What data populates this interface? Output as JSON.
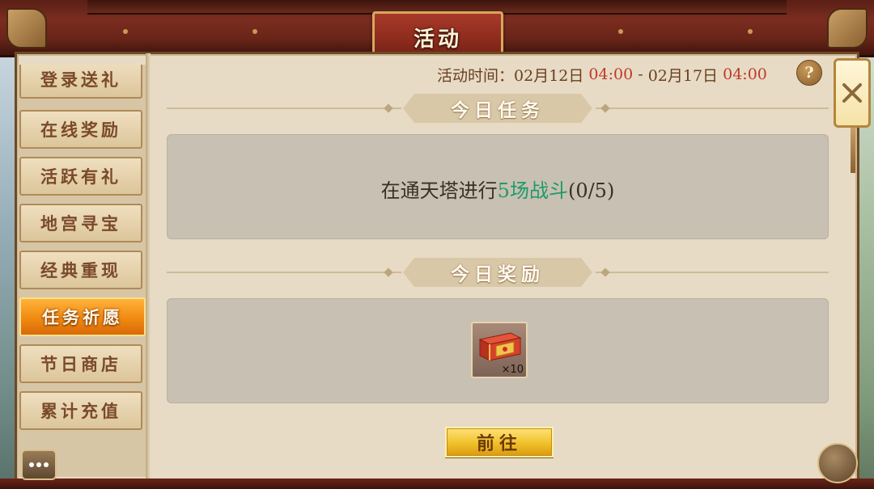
{
  "window": {
    "title": "活动"
  },
  "sidebar": {
    "items": [
      {
        "label": "登录送礼",
        "active": false
      },
      {
        "label": "在线奖励",
        "active": false
      },
      {
        "label": "活跃有礼",
        "active": false
      },
      {
        "label": "地宫寻宝",
        "active": false
      },
      {
        "label": "经典重现",
        "active": false
      },
      {
        "label": "任务祈愿",
        "active": true
      },
      {
        "label": "节日商店",
        "active": false
      },
      {
        "label": "累计充值",
        "active": false
      }
    ]
  },
  "event_time": {
    "label": "活动时间：",
    "start_date": "02月12日",
    "start_time": "04:00",
    "separator": "-",
    "end_date": "02月17日",
    "end_time": "04:00"
  },
  "help": {
    "label": "?"
  },
  "today_task": {
    "title": "今日任务",
    "text_prefix": "在通天塔进行",
    "text_highlight": "5场战斗",
    "progress": "(0/5)"
  },
  "today_reward": {
    "title": "今日奖励",
    "items": [
      {
        "icon": "treasure-chest-icon",
        "count": "×10"
      }
    ]
  },
  "go_button": {
    "label": "前往"
  },
  "colors": {
    "active_tab": "#f08a12",
    "time_red": "#c0392b",
    "task_green": "#1f9a6a",
    "button_gold": "#f0c02a"
  }
}
